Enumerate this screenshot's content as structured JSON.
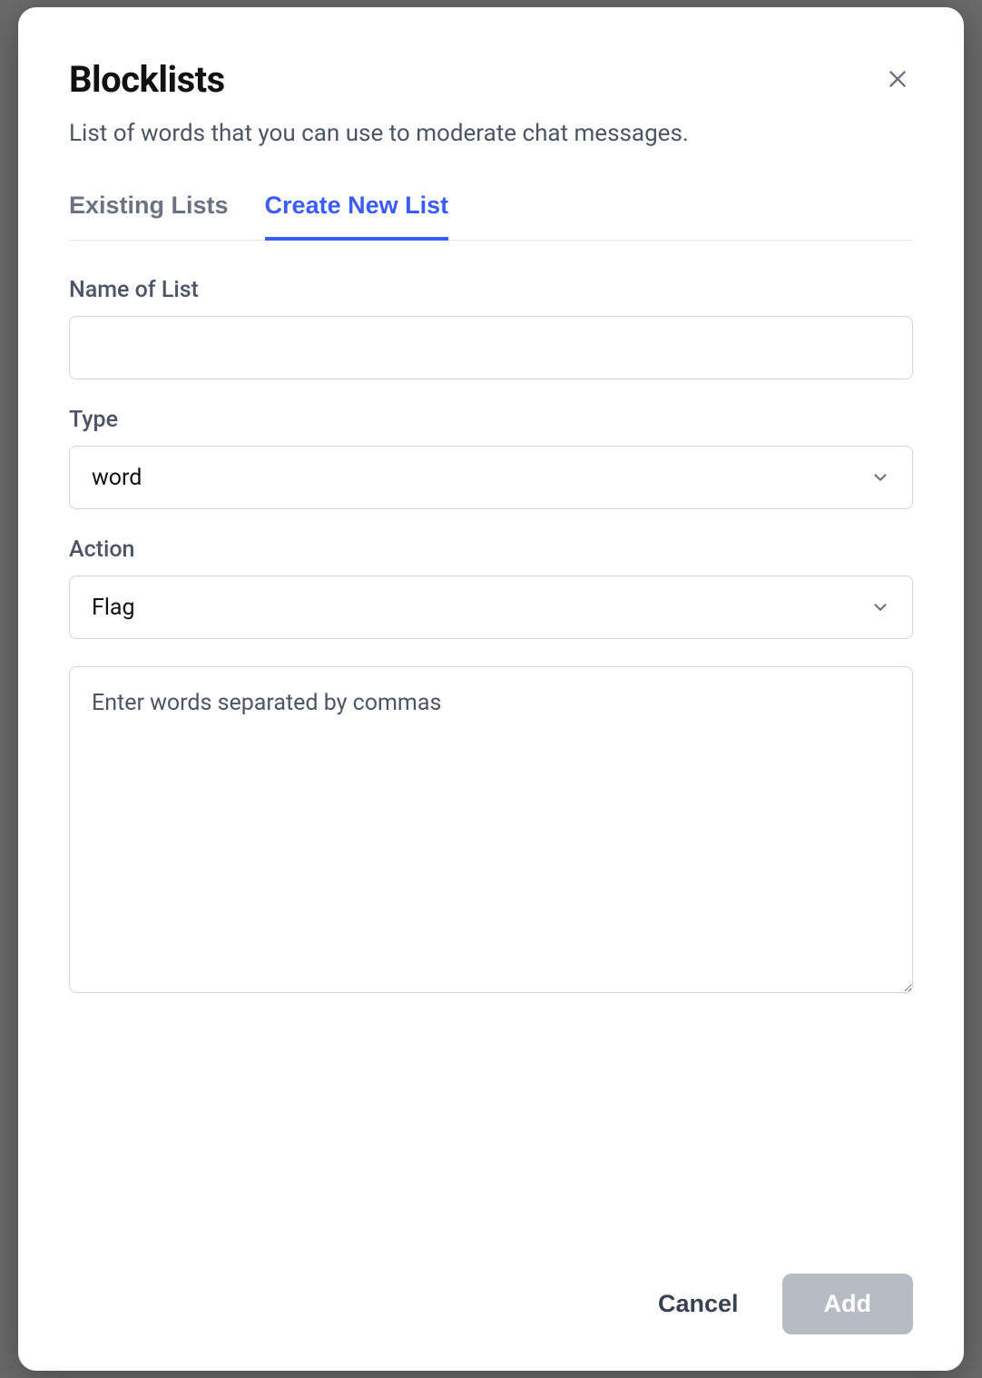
{
  "modal": {
    "title": "Blocklists",
    "subtitle": "List of words that you can use to moderate chat messages."
  },
  "tabs": {
    "existing": "Existing Lists",
    "create": "Create New List",
    "activeIndex": 1
  },
  "form": {
    "name": {
      "label": "Name of List",
      "value": ""
    },
    "type": {
      "label": "Type",
      "selected": "word"
    },
    "action": {
      "label": "Action",
      "selected": "Flag"
    },
    "words": {
      "placeholder": "Enter words separated by commas",
      "value": ""
    }
  },
  "footer": {
    "cancel": "Cancel",
    "add": "Add"
  }
}
